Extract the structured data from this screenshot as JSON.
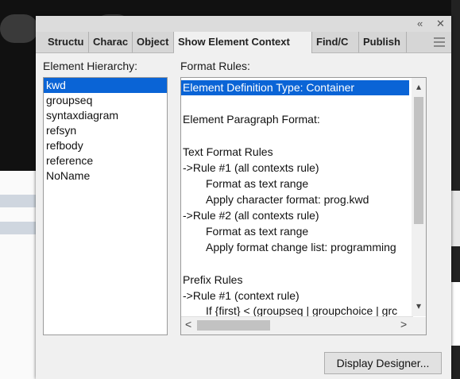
{
  "window": {
    "collapse_icon": "«",
    "close_icon": "✕"
  },
  "tabs": [
    {
      "label": "Structu"
    },
    {
      "label": "Charac"
    },
    {
      "label": "Object"
    },
    {
      "label": "Show Element Context"
    },
    {
      "label": "Find/C"
    },
    {
      "label": "Publish"
    }
  ],
  "hierarchy": {
    "label": "Element Hierarchy:",
    "items": [
      "kwd",
      "groupseq",
      "syntaxdiagram",
      "refsyn",
      "refbody",
      "reference",
      "NoName"
    ],
    "selected": "kwd"
  },
  "format_rules": {
    "label": "Format Rules:",
    "lines": [
      "Element Definition Type: Container",
      "",
      "Element Paragraph Format:",
      "",
      "Text Format Rules",
      "->Rule #1  (all contexts rule)",
      "        Format as text range",
      "        Apply character format:  prog.kwd",
      "->Rule #2  (all contexts rule)",
      "        Format as text range",
      "        Apply format change list:  programming",
      "",
      "Prefix Rules",
      "->Rule #1  (context rule)",
      "        If  {first} < (groupseq | groupchoice | grc"
    ]
  },
  "scroll_icons": {
    "up": "▴",
    "down": "▾",
    "left": "<",
    "right": ">"
  },
  "display_designer_button": "Display Designer...",
  "colors": {
    "selection": "#0a64d6",
    "panel_bg": "#f0f0f0",
    "tab_bar": "#d6d6d6"
  }
}
